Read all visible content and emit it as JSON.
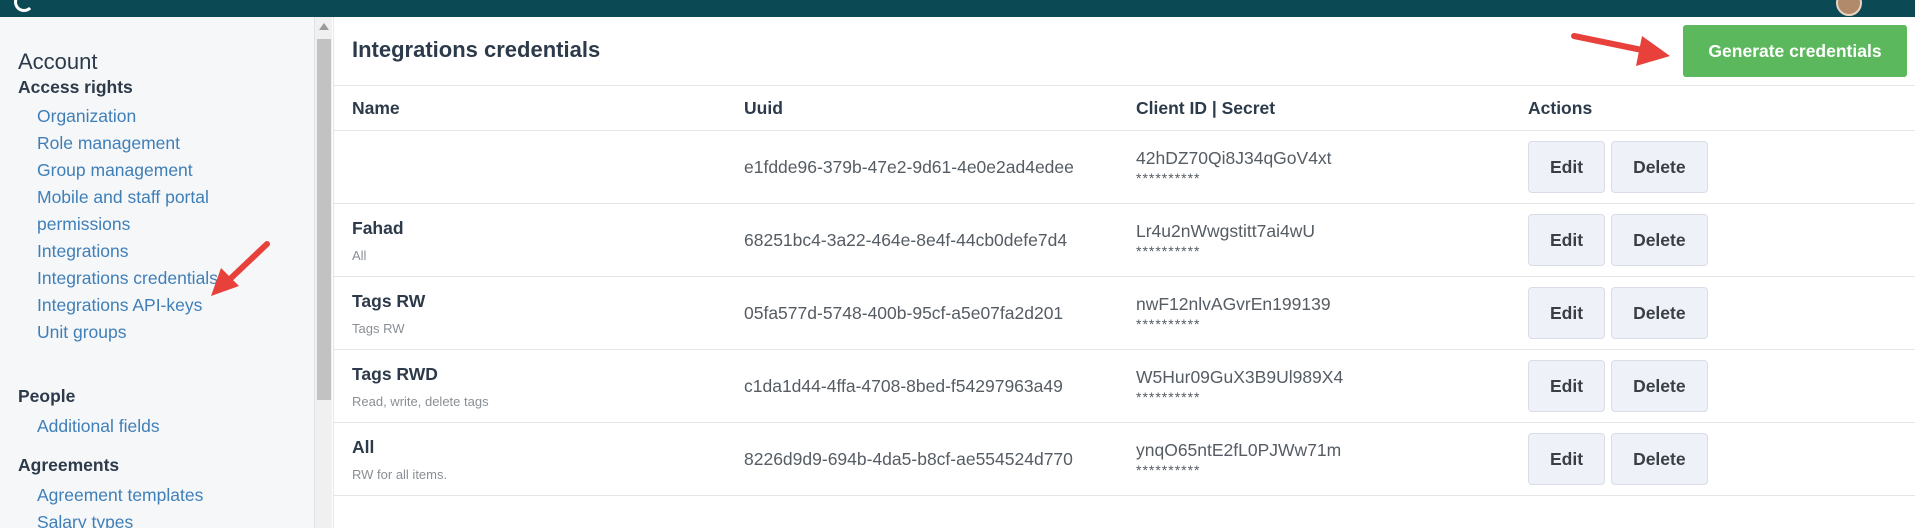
{
  "sidebar": {
    "heading": "Account",
    "sections": {
      "access_rights": "Access rights",
      "people": "People",
      "agreements": "Agreements"
    },
    "links": {
      "organization": "Organization",
      "role_management": "Role management",
      "group_management": "Group management",
      "mobile_line1": "Mobile and staff portal",
      "mobile_line2": "permissions",
      "integrations": "Integrations",
      "integrations_credentials": "Integrations credentials",
      "integrations_api_keys": "Integrations API-keys",
      "unit_groups": "Unit groups",
      "additional_fields": "Additional fields",
      "agreement_templates": "Agreement templates",
      "salary_types": "Salary types"
    }
  },
  "main": {
    "title": "Integrations credentials",
    "generate_button": "Generate credentials",
    "columns": {
      "name": "Name",
      "uuid": "Uuid",
      "client": "Client ID | Secret",
      "actions": "Actions"
    },
    "rows": [
      {
        "name": "",
        "desc": "",
        "uuid": "e1fdde96-379b-47e2-9d61-4e0e2ad4edee",
        "client_id": "42hDZ70Qi8J34qGoV4xt",
        "secret": "**********"
      },
      {
        "name": "Fahad",
        "desc": "All",
        "uuid": "68251bc4-3a22-464e-8e4f-44cb0defe7d4",
        "client_id": "Lr4u2nWwgstitt7ai4wU",
        "secret": "**********"
      },
      {
        "name": "Tags RW",
        "desc": "Tags RW",
        "uuid": "05fa577d-5748-400b-95cf-a5e07fa2d201",
        "client_id": "nwF12nlvAGvrEn199139",
        "secret": "**********"
      },
      {
        "name": "Tags RWD",
        "desc": "Read, write, delete tags",
        "uuid": "c1da1d44-4ffa-4708-8bed-f54297963a49",
        "client_id": "W5Hur09GuX3B9Ul989X4",
        "secret": "**********"
      },
      {
        "name": "All",
        "desc": "RW for all items.",
        "uuid": "8226d9d9-694b-4da5-b8cf-ae554524d770",
        "client_id": "ynqO65ntE2fL0PJWw71m",
        "secret": "**********"
      }
    ],
    "edit_label": "Edit",
    "delete_label": "Delete"
  },
  "colors": {
    "topbar": "#0b4a55",
    "link": "#3f7fb8",
    "primary_button": "#5cb85c",
    "annotation_arrow": "#e8413c"
  },
  "icons": [
    "logo-icon",
    "avatar",
    "scroll-up-icon",
    "annotation-arrow"
  ]
}
